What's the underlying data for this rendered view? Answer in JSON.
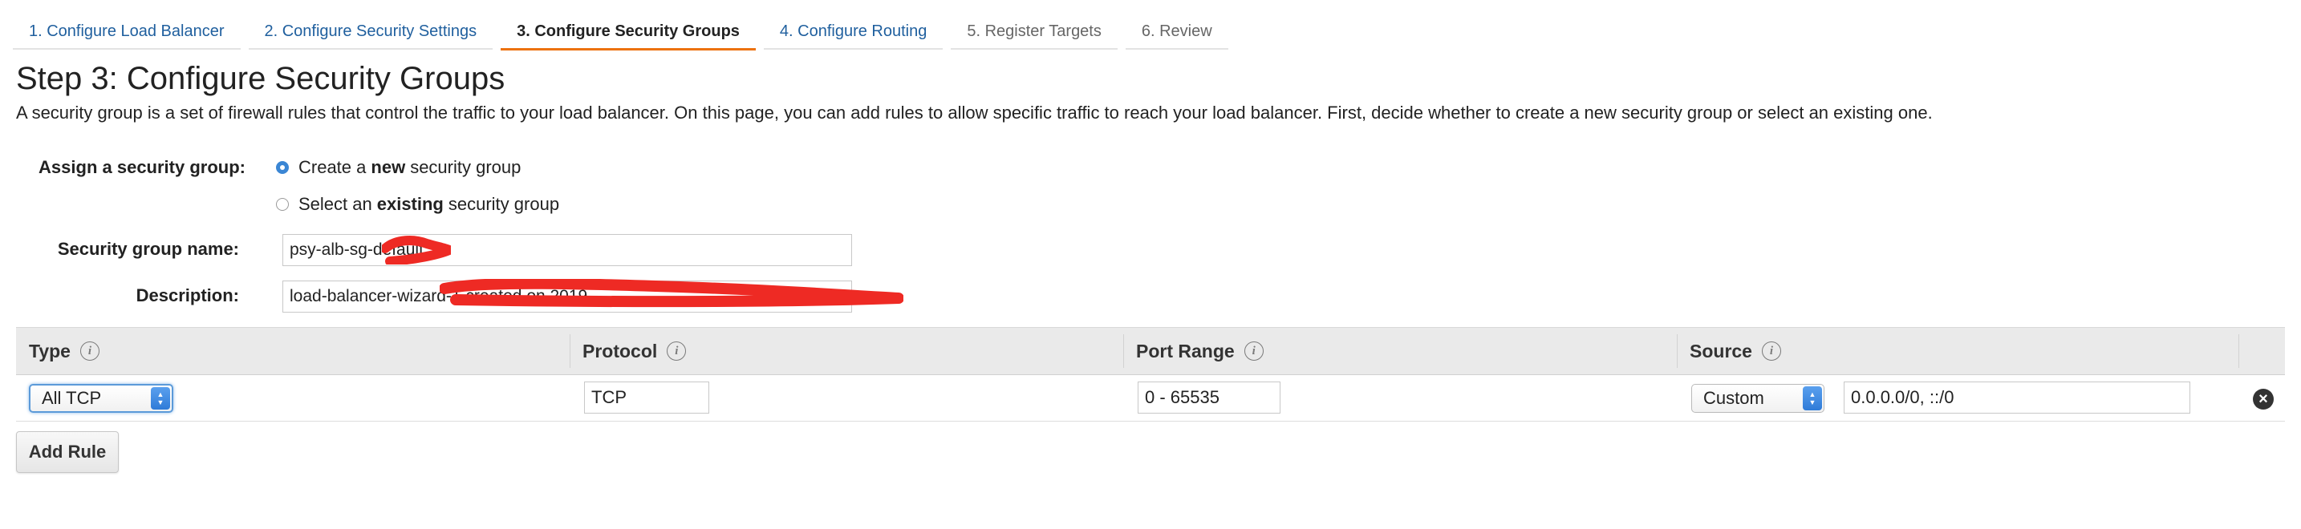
{
  "wizard": {
    "steps": [
      {
        "label": "1. Configure Load Balancer",
        "state": "done"
      },
      {
        "label": "2. Configure Security Settings",
        "state": "done"
      },
      {
        "label": "3. Configure Security Groups",
        "state": "active"
      },
      {
        "label": "4. Configure Routing",
        "state": "next"
      },
      {
        "label": "5. Register Targets",
        "state": "future"
      },
      {
        "label": "6. Review",
        "state": "future"
      }
    ],
    "accent_color": "#ec7211",
    "link_color": "#1f5f9e"
  },
  "page": {
    "title": "Step 3: Configure Security Groups",
    "intro": "A security group is a set of firewall rules that control the traffic to your load balancer. On this page, you can add rules to allow specific traffic to reach your load balancer. First, decide whether to create a new security group or select an existing one."
  },
  "form": {
    "assign_label": "Assign a security group:",
    "options": [
      {
        "before": "Create a",
        "bold": "new",
        "after": "security group",
        "checked": true
      },
      {
        "before": "Select an",
        "bold": "existing",
        "after": "security group",
        "checked": false
      }
    ],
    "name_label": "Security group name:",
    "name_value": "psy-alb-sg-default",
    "description_label": "Description:",
    "description_value": "load-balancer-wizard-1 created on 2019-",
    "redaction_color": "#ee2a24"
  },
  "rules_table": {
    "headers": [
      {
        "label": "Type",
        "icon": "info-icon"
      },
      {
        "label": "Protocol",
        "icon": "info-icon"
      },
      {
        "label": "Port Range",
        "icon": "info-icon"
      },
      {
        "label": "Source",
        "icon": "info-icon"
      }
    ],
    "rows": [
      {
        "type": "All TCP",
        "protocol": "TCP",
        "port_range": "0 - 65535",
        "source_mode": "Custom",
        "source_cidr": "0.0.0.0/0, ::/0",
        "remove_icon": "close-circle-icon"
      }
    ],
    "add_rule_label": "Add Rule"
  }
}
